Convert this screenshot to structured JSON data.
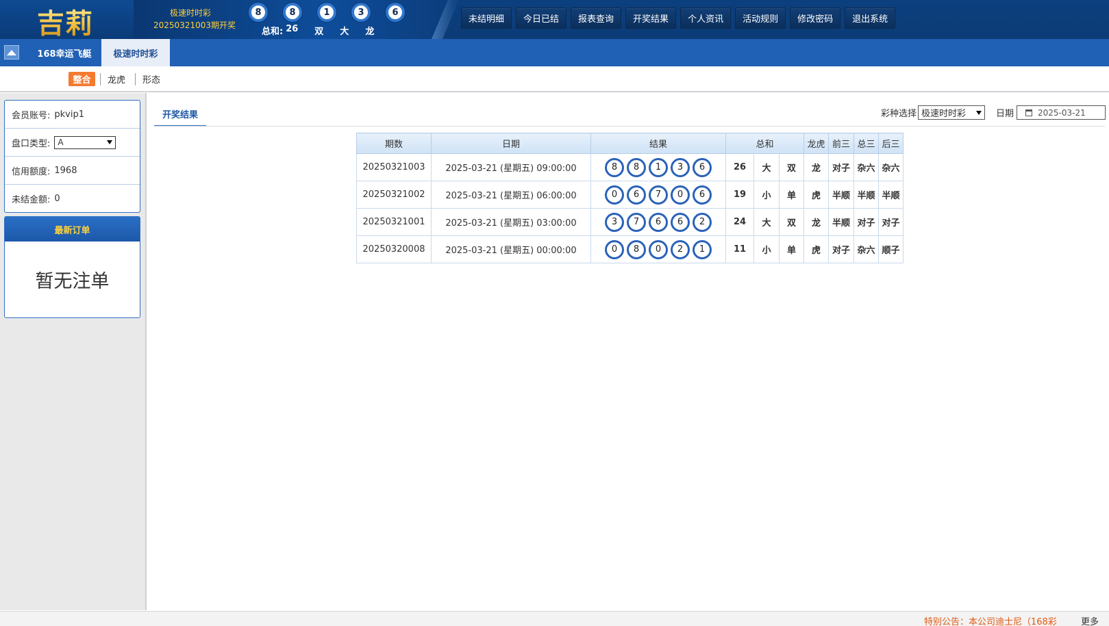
{
  "brand": {
    "logo_text": "吉莉"
  },
  "draw": {
    "lottery_name": "极速时时彩",
    "issue_text": "20250321003期开奖",
    "balls": [
      "8",
      "8",
      "1",
      "3",
      "6"
    ],
    "sum_label": "总和:",
    "sum_value": "26",
    "odd_even": "双",
    "big_small": "大",
    "dragon_tiger": "龙"
  },
  "nav": {
    "items": [
      "未结明细",
      "今日已结",
      "报表查询",
      "开奖结果",
      "个人资讯",
      "活动规则",
      "修改密码",
      "退出系统"
    ]
  },
  "games": {
    "tabs": [
      "168幸运飞艇",
      "极速时时彩"
    ],
    "active": "极速时时彩"
  },
  "subtabs": {
    "items": [
      "整合",
      "龙虎",
      "形态"
    ],
    "active": "整合"
  },
  "account": {
    "member_label": "会员账号:",
    "member_value": "pkvip1",
    "handicap_label": "盘口类型:",
    "handicap_value": "A",
    "credit_label": "信用额度:",
    "credit_value": "1968",
    "unsettled_label": "未结金额:",
    "unsettled_value": "0"
  },
  "orders": {
    "title": "最新订单",
    "empty_text": "暂无注单"
  },
  "results": {
    "tab_label": "开奖结果",
    "lottery_select_label": "彩种选择",
    "lottery_select_value": "极速时时彩",
    "date_label": "日期",
    "date_value": "2025-03-21",
    "columns": [
      "期数",
      "日期",
      "结果",
      "总和",
      "龙虎",
      "前三",
      "总三",
      "后三"
    ],
    "rows": [
      {
        "issue": "20250321003",
        "date": "2025-03-21 (星期五) 09:00:00",
        "balls": [
          "8",
          "8",
          "1",
          "3",
          "6"
        ],
        "sum": "26",
        "big_small": "大",
        "odd_even": "双",
        "dragon_tiger": "龙",
        "front3": "对子",
        "mid3": "杂六",
        "back3": "杂六"
      },
      {
        "issue": "20250321002",
        "date": "2025-03-21 (星期五) 06:00:00",
        "balls": [
          "0",
          "6",
          "7",
          "0",
          "6"
        ],
        "sum": "19",
        "big_small": "小",
        "odd_even": "单",
        "dragon_tiger": "虎",
        "front3": "半顺",
        "mid3": "半顺",
        "back3": "半顺"
      },
      {
        "issue": "20250321001",
        "date": "2025-03-21 (星期五) 03:00:00",
        "balls": [
          "3",
          "7",
          "6",
          "6",
          "2"
        ],
        "sum": "24",
        "big_small": "大",
        "odd_even": "双",
        "dragon_tiger": "龙",
        "front3": "半顺",
        "mid3": "对子",
        "back3": "对子"
      },
      {
        "issue": "20250320008",
        "date": "2025-03-21 (星期五) 00:00:00",
        "balls": [
          "0",
          "8",
          "0",
          "2",
          "1"
        ],
        "sum": "11",
        "big_small": "小",
        "odd_even": "单",
        "dragon_tiger": "虎",
        "front3": "对子",
        "mid3": "杂六",
        "back3": "顺子"
      }
    ]
  },
  "footer": {
    "notice": "特别公告：本公司迪士尼（168彩",
    "more": "更多"
  },
  "colors": {
    "header_bg": "#0c3c76",
    "tabbar_bg": "#2060b5",
    "accent_orange": "#f47a30",
    "ball_ring": "#2a62b8",
    "result_red": "#e8170b",
    "gold": "#ffcf3a"
  }
}
